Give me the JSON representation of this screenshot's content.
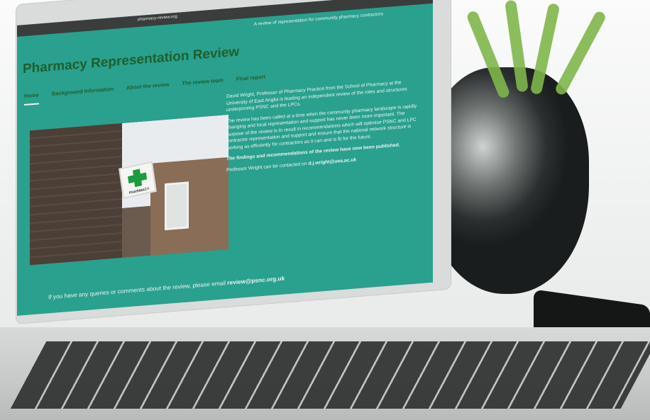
{
  "page": {
    "url": "pharmacy-review.org",
    "tagline": "A review of representation for community pharmacy contractors",
    "site_title": "Pharmacy Representation Review",
    "nav": [
      {
        "label": "Home",
        "active": true
      },
      {
        "label": "Background Information"
      },
      {
        "label": "About the review"
      },
      {
        "label": "The review team"
      },
      {
        "label": "Final report"
      }
    ],
    "photo_sign_text": "PHARMACY",
    "intro_paragraphs": [
      "David Wright, Professor of Pharmacy Practice from the School of Pharmacy at the University of East Anglia is leading an independent review of the roles and structures underpinning PSNC and the LPCs.",
      "The review has been called at a time when the community pharmacy landscape is rapidly changing and local representation and support has never been more important. The purpose of the review is to result in recommendations which will optimise PSNC and LPC contractor representation and support and ensure that the national network structure is working as efficiently for contractors as it can and is fit for the future."
    ],
    "findings_text": "The findings and recommendations of the review have now been published.",
    "contact_prefix": "Professor Wright can be contacted on ",
    "contact_email": "d.j.wright@uea.ac.uk",
    "footer_prefix": "If you have any queries or comments about the review, please email ",
    "footer_email": "review@psnc.org.uk"
  },
  "colors": {
    "site_bg": "#2aa08e",
    "title": "#1f5f2c",
    "text": "#eaf6f3",
    "cross": "#1b9c3d"
  }
}
